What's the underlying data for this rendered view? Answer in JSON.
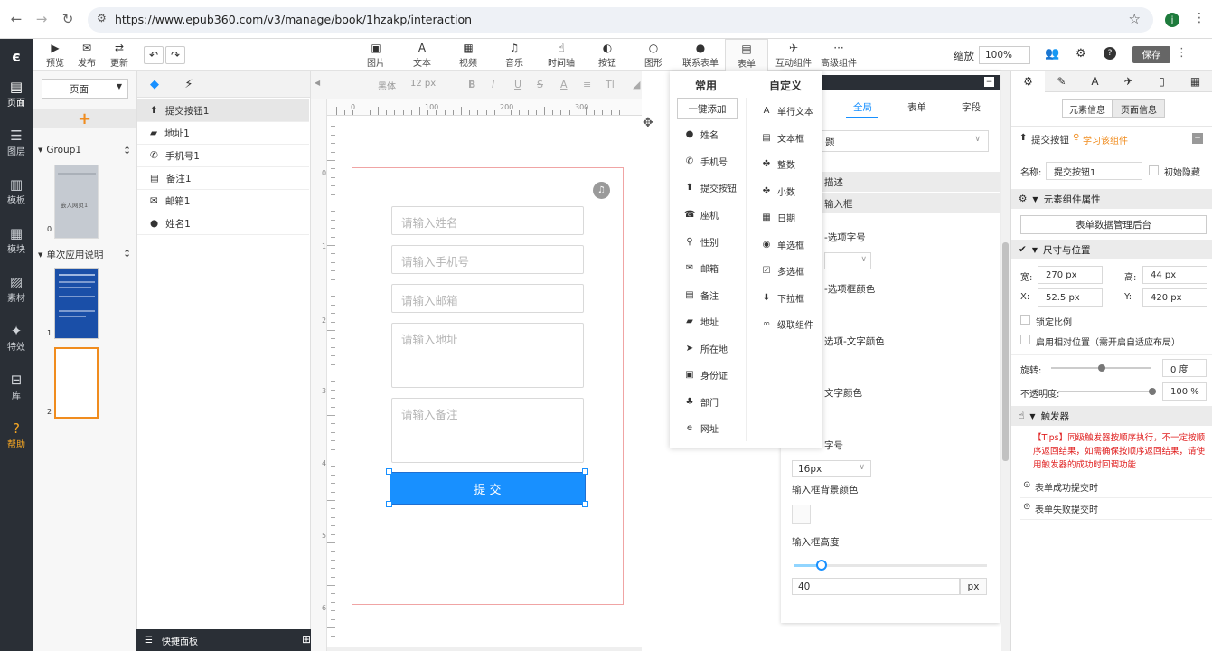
{
  "browser": {
    "url": "https://www.epub360.com/v3/manage/book/1hzakp/interaction",
    "avatar": "j"
  },
  "toolbar": {
    "left": [
      {
        "label": "预览",
        "icon": "preview-icon"
      },
      {
        "label": "发布",
        "icon": "publish-icon"
      },
      {
        "label": "更新",
        "icon": "update-icon"
      }
    ],
    "center": [
      {
        "label": "图片",
        "icon": "image-icon"
      },
      {
        "label": "文本",
        "icon": "text-icon"
      },
      {
        "label": "视频",
        "icon": "video-icon"
      },
      {
        "label": "音乐",
        "icon": "music-icon"
      },
      {
        "label": "时间轴",
        "icon": "timeline-icon"
      },
      {
        "label": "按钮",
        "icon": "button-icon"
      },
      {
        "label": "图形",
        "icon": "shape-icon"
      },
      {
        "label": "联系表单",
        "icon": "contact-icon"
      },
      {
        "label": "表单",
        "icon": "form-icon"
      },
      {
        "label": "互动组件",
        "icon": "interact-icon"
      },
      {
        "label": "高级组件",
        "icon": "advanced-icon"
      }
    ],
    "zoom_label": "缩放",
    "zoom_value": "100%",
    "save": "保存"
  },
  "leftnav": [
    {
      "label": "页面"
    },
    {
      "label": "图层"
    },
    {
      "label": "模板"
    },
    {
      "label": "模块"
    },
    {
      "label": "素材"
    },
    {
      "label": "特效"
    },
    {
      "label": "库"
    },
    {
      "label": "帮助"
    }
  ],
  "pages": {
    "select": "页面",
    "add": "+",
    "groups": [
      {
        "name": "Group1",
        "thumb": "嵌入网页1",
        "num": "0"
      },
      {
        "name": "单次应用说明",
        "num1": "1",
        "num2": "2"
      }
    ]
  },
  "layers": [
    {
      "label": "提交按钮1",
      "icon": "upload-icon"
    },
    {
      "label": "地址1",
      "icon": "book-icon"
    },
    {
      "label": "手机号1",
      "icon": "phone-icon"
    },
    {
      "label": "备注1",
      "icon": "table-icon"
    },
    {
      "label": "邮箱1",
      "icon": "mail-icon"
    },
    {
      "label": "姓名1",
      "icon": "person-icon"
    }
  ],
  "quickpanel": "快捷面板",
  "format": {
    "font": "黑体",
    "size": "12 px"
  },
  "ruler": [
    "0",
    "100",
    "200",
    "300"
  ],
  "vruler": [
    "0",
    "1",
    "2",
    "3",
    "4",
    "5",
    "6"
  ],
  "form": {
    "name": "请输入姓名",
    "phone": "请输入手机号",
    "email": "请输入邮箱",
    "address": "请输入地址",
    "note": "请输入备注",
    "submit": "提 交"
  },
  "popup": {
    "col1_title": "常用",
    "col2_title": "自定义",
    "one_click": "一键添加",
    "col1": [
      {
        "l": "姓名",
        "i": "person-icon"
      },
      {
        "l": "手机号",
        "i": "phone-icon"
      },
      {
        "l": "提交按钮",
        "i": "upload-icon"
      },
      {
        "l": "座机",
        "i": "landline-icon"
      },
      {
        "l": "性别",
        "i": "gender-icon"
      },
      {
        "l": "邮箱",
        "i": "mail-icon"
      },
      {
        "l": "备注",
        "i": "table-icon"
      },
      {
        "l": "地址",
        "i": "book-icon"
      },
      {
        "l": "所在地",
        "i": "location-icon"
      },
      {
        "l": "身份证",
        "i": "id-card-icon"
      },
      {
        "l": "部门",
        "i": "org-icon"
      },
      {
        "l": "网址",
        "i": "web-icon"
      }
    ],
    "col2": [
      {
        "l": "单行文本",
        "i": "text-icon"
      },
      {
        "l": "文本框",
        "i": "textbox-icon"
      },
      {
        "l": "整数",
        "i": "puzzle-icon"
      },
      {
        "l": "小数",
        "i": "puzzle-icon"
      },
      {
        "l": "日期",
        "i": "calendar-icon"
      },
      {
        "l": "单选框",
        "i": "radio-icon"
      },
      {
        "l": "多选框",
        "i": "checkbox-icon"
      },
      {
        "l": "下拉框",
        "i": "dropdown-icon"
      },
      {
        "l": "级联组件",
        "i": "link-icon"
      }
    ]
  },
  "fpanel": {
    "tabs": [
      "全局",
      "表单",
      "字段"
    ],
    "items": [
      "描述",
      "输入框",
      "-选项字号",
      "-选项框颜色",
      "选项-文字颜色",
      "文字颜色",
      "字号"
    ],
    "fontsize": "16px",
    "bg_label": "输入框背景颜色",
    "height_label": "输入框高度",
    "height_val": "40",
    "unit": "px",
    "select_text": "题"
  },
  "rpanel": {
    "subtabs": [
      "元素信息",
      "页面信息"
    ],
    "element": "提交按钮",
    "learn": "学习该组件",
    "name_label": "名称:",
    "name_value": "提交按钮1",
    "hidden": "初始隐藏",
    "props": "元素组件属性",
    "backend": "表单数据管理后台",
    "sizepos": "尺寸与位置",
    "w_label": "宽:",
    "w": "270 px",
    "h_label": "高:",
    "h": "44 px",
    "x_label": "X:",
    "x": "52.5 px",
    "y_label": "Y:",
    "y": "420 px",
    "lock": "锁定比例",
    "relative": "启用相对位置（需开启自适应布局）",
    "rotate_label": "旋转:",
    "rotate": "0 度",
    "opacity_label": "不透明度:",
    "opacity": "100 %",
    "trigger": "触发器",
    "tips": "【Tips】同级触发器按顺序执行，不一定按顺序返回结果，如需确保按顺序返回结果，请使用触发器的成功时回调功能",
    "t1": "表单成功提交时",
    "t2": "表单失败提交时",
    "accent": "#1890ff",
    "danger": "#e02020"
  }
}
